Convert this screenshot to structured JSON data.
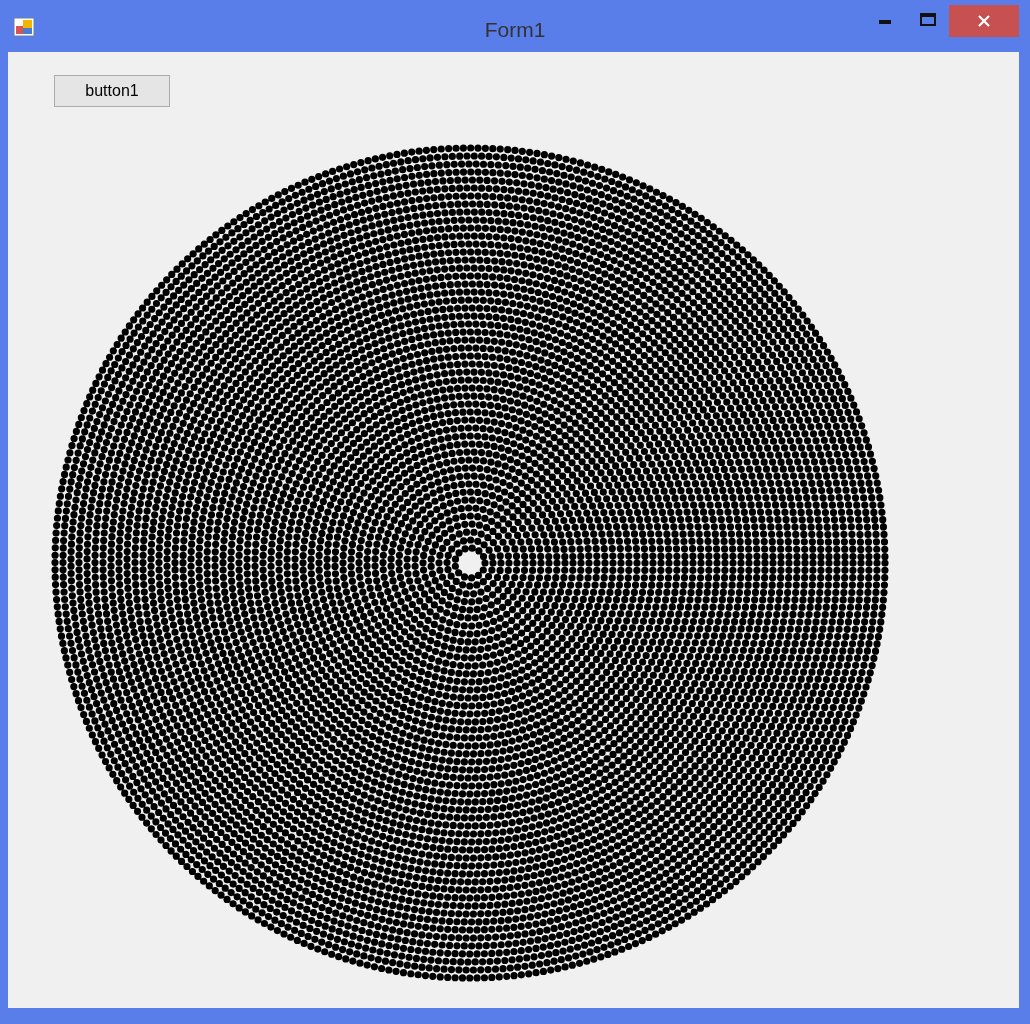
{
  "window": {
    "title": "Form1"
  },
  "buttons": [
    {
      "label": "button1"
    }
  ]
}
